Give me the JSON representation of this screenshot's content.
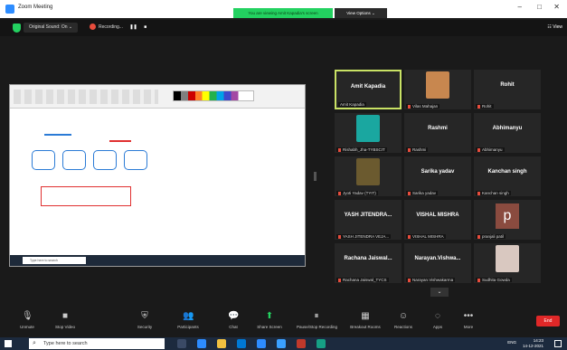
{
  "window": {
    "title": "Zoom Meeting",
    "viewing_banner": "You are viewing Amit Kapadia's screen",
    "view_options": "View Options ⌄",
    "controls": [
      "–",
      "□",
      "✕"
    ]
  },
  "topbar": {
    "original_sound": "Original Sound: On ⌄",
    "recording": "Recording...",
    "pause_icon": "❚❚",
    "stop_icon": "■",
    "view_label": "☷ View"
  },
  "shared_screen": {
    "taskbar_search": "Type here to search"
  },
  "participants": [
    {
      "center_name": "Amit Kapadia",
      "label": "Amit Kapadia",
      "active": true,
      "type": "name"
    },
    {
      "center_name": "",
      "label": "Vilas Mahajan",
      "type": "photo",
      "photo_color": "#c8874f"
    },
    {
      "center_name": "Rohit",
      "label": "Rohit",
      "type": "name"
    },
    {
      "center_name": "",
      "label": "Rishabh_Jha-TYBSCIT",
      "type": "photo",
      "photo_color": "#1aa7a0"
    },
    {
      "center_name": "Rashmi",
      "label": "Rashmi",
      "type": "name"
    },
    {
      "center_name": "Abhimanyu",
      "label": "Abhimanyu",
      "type": "name"
    },
    {
      "center_name": "",
      "label": "Jyoti Yadav (TYIT)",
      "type": "photo",
      "photo_color": "#6b5a2f"
    },
    {
      "center_name": "Sarika yadav",
      "label": "Sarika yadav",
      "type": "name"
    },
    {
      "center_name": "Kanchan singh",
      "label": "Kanchan singh",
      "type": "name"
    },
    {
      "center_name": "YASH JITENDRA...",
      "label": "YASH JITENDRA VEJA...",
      "type": "name"
    },
    {
      "center_name": "VISHAL MISHRA",
      "label": "VISHAL MISHRA",
      "type": "name"
    },
    {
      "center_name": "p",
      "label": "pranjali patil",
      "type": "avatar"
    },
    {
      "center_name": "Rachana Jaiswal...",
      "label": "Rachana Jaiswal_TYCS",
      "type": "name"
    },
    {
      "center_name": "Narayan.Vishwa...",
      "label": "Narayan.Vishwakarma",
      "type": "name"
    },
    {
      "center_name": "",
      "label": "Sudhita Gowda",
      "type": "photo",
      "photo_color": "#d9c8c0"
    }
  ],
  "controls": {
    "unmute": "Unmute",
    "stop_video": "Stop Video",
    "security": "Security",
    "participants": "Participants",
    "participants_count": "100",
    "chat": "Chat",
    "share_screen": "Share Screen",
    "pause_recording": "Pause/Stop Recording",
    "breakout_rooms": "Breakout Rooms",
    "reactions": "Reactions",
    "apps": "Apps",
    "more": "More",
    "end": "End"
  },
  "taskbar": {
    "search_placeholder": "Type here to search",
    "lang": "ENG",
    "time": "14:23",
    "date": "14-12-2021"
  }
}
